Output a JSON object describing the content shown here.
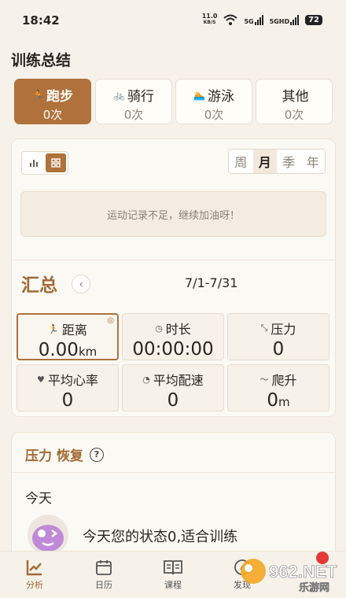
{
  "status_bar": {
    "time": "18:42",
    "net_speed_value": "11.0",
    "net_speed_unit": "KB/S",
    "sim1": "5G",
    "sim2": "5GHD",
    "battery": "72"
  },
  "summary_title": "训练总结",
  "sport_tabs": [
    {
      "icon": "running-icon",
      "label": "跑步",
      "count": "0次",
      "active": true
    },
    {
      "icon": "cycling-icon",
      "label": "骑行",
      "count": "0次",
      "active": false
    },
    {
      "icon": "swimming-icon",
      "label": "游泳",
      "count": "0次",
      "active": false
    },
    {
      "icon": "other-icon",
      "label": "其他",
      "count": "0次",
      "active": false
    }
  ],
  "period_tabs": [
    "周",
    "月",
    "季",
    "年"
  ],
  "active_period": "月",
  "empty_message": "运动记录不足，继续加油呀！",
  "totals": {
    "title": "汇总",
    "date_range": "7/1-7/31"
  },
  "stats": [
    {
      "icon": "running-icon",
      "label": "距离",
      "value": "0.00",
      "unit": "km"
    },
    {
      "icon": "clock-icon",
      "label": "时长",
      "value": "00:00:00",
      "unit": ""
    },
    {
      "icon": "pressure-icon",
      "label": "压力",
      "value": "0",
      "unit": ""
    },
    {
      "icon": "heart-icon",
      "label": "平均心率",
      "value": "0",
      "unit": ""
    },
    {
      "icon": "speed-icon",
      "label": "平均配速",
      "value": "0",
      "unit": ""
    },
    {
      "icon": "climb-icon",
      "label": "爬升",
      "value": "0",
      "unit": "m"
    }
  ],
  "recovery": {
    "title": "压力 恢复",
    "help": "?",
    "today_label": "今天",
    "status_text": "今天您的状态0,适合训练"
  },
  "bottom_nav": [
    {
      "icon": "analysis-icon",
      "label": "分析",
      "active": true
    },
    {
      "icon": "calendar-icon",
      "label": "日历",
      "active": false
    },
    {
      "icon": "course-icon",
      "label": "课程",
      "active": false
    },
    {
      "icon": "discover-icon",
      "label": "发现",
      "active": false
    }
  ],
  "watermark": {
    "text": "962.NET",
    "subtext": "乐游网"
  },
  "colors": {
    "accent": "#b0713a",
    "title_accent": "#a36a35",
    "background": "#f6f2ea"
  }
}
